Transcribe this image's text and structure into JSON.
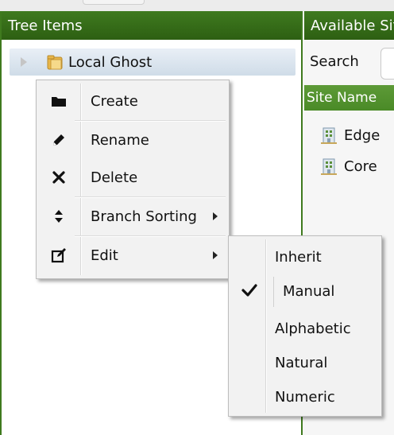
{
  "left_panel": {
    "title": "Tree Items",
    "tree_item": {
      "label": "Local Ghost",
      "icon": "folder-icon",
      "expander": "collapsed"
    }
  },
  "right_panel": {
    "title": "Available Sites",
    "search_label": "Search",
    "search_value": "",
    "column_header": "Site Name",
    "sites": [
      {
        "name": "Edge",
        "icon": "building-icon"
      },
      {
        "name": "Core",
        "icon": "building-icon"
      }
    ]
  },
  "context_menu": {
    "items": [
      {
        "label": "Create",
        "icon": "folder-icon"
      },
      {
        "label": "Rename",
        "icon": "pencil-icon"
      },
      {
        "label": "Delete",
        "icon": "close-icon"
      },
      {
        "label": "Branch Sorting",
        "icon": "sort-icon",
        "submenu": true
      },
      {
        "label": "Edit",
        "icon": "edit-icon",
        "submenu": true
      }
    ]
  },
  "sorting_submenu": {
    "items": [
      {
        "label": "Inherit",
        "checked": false
      },
      {
        "label": "Manual",
        "checked": true
      },
      {
        "label": "Alphabetic",
        "checked": false
      },
      {
        "label": "Natural",
        "checked": false
      },
      {
        "label": "Numeric",
        "checked": false
      }
    ]
  },
  "colors": {
    "header_green": "#2d5f12",
    "column_header_green": "#4a8a27",
    "menu_background": "#f2f2f2"
  }
}
